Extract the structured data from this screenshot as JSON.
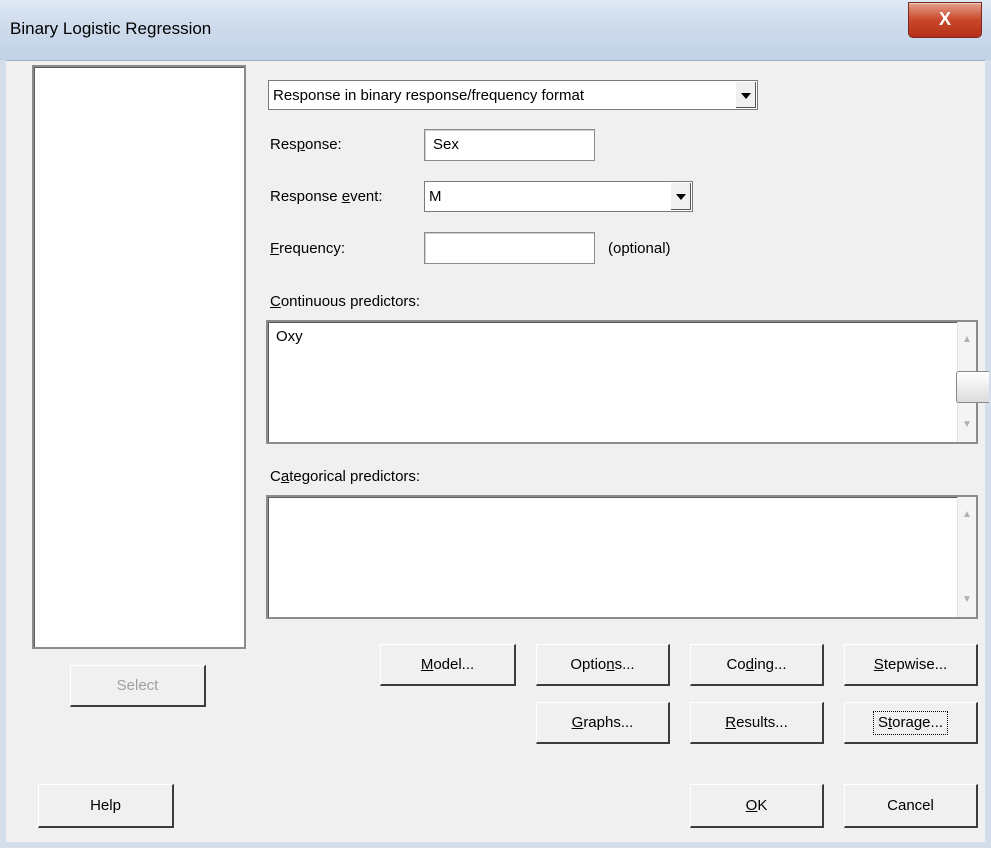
{
  "window": {
    "title": "Binary Logistic Regression",
    "close_glyph": "X"
  },
  "format_select": {
    "value": "Response in binary response/frequency format"
  },
  "response": {
    "label": "Response:",
    "label_underline_index": 3,
    "value": "Sex"
  },
  "response_event": {
    "label": "Response event:",
    "value": "M"
  },
  "frequency": {
    "label": "Frequency:",
    "value": "",
    "hint": "(optional)"
  },
  "continuous": {
    "label": "Continuous predictors:",
    "value": "Oxy"
  },
  "categorical": {
    "label": "Categorical predictors:",
    "value": ""
  },
  "buttons": {
    "select": "Select",
    "model": "Model...",
    "options": "Options...",
    "coding": "Coding...",
    "stepwise": "Stepwise...",
    "graphs": "Graphs...",
    "results": "Results...",
    "storage": "Storage...",
    "help": "Help",
    "ok": "OK",
    "cancel": "Cancel"
  },
  "colors": {
    "close_button": "#c9482b",
    "titlebar": "#cfdcec",
    "dialog_bg": "#f0f0f0"
  }
}
